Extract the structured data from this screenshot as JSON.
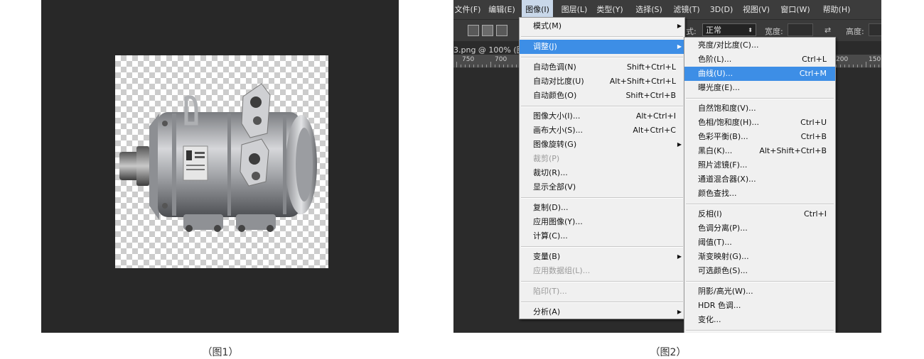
{
  "fig1": {
    "caption": "（图1）"
  },
  "fig2": {
    "caption": "（图2）",
    "menubar": [
      {
        "label": "文件(F)"
      },
      {
        "label": "编辑(E)"
      },
      {
        "label": "图像(I)",
        "active": true
      },
      {
        "label": "图层(L)"
      },
      {
        "label": "类型(Y)"
      },
      {
        "label": "选择(S)"
      },
      {
        "label": "滤镜(T)"
      },
      {
        "label": "3D(D)"
      },
      {
        "label": "视图(V)"
      },
      {
        "label": "窗口(W)"
      },
      {
        "label": "帮助(H)"
      }
    ],
    "options": {
      "mode_label": "式:",
      "mode_value": "正常",
      "width_label": "宽度:",
      "height_label": "高度:"
    },
    "doc_tab": "3.png @ 100% (图",
    "ruler_left": [
      "750",
      "700"
    ],
    "ruler_right": [
      "200",
      "150"
    ],
    "image_menu": [
      {
        "label": "模式(M)",
        "submenu": true
      },
      {
        "sep": true
      },
      {
        "label": "调整(J)",
        "submenu": true,
        "highlight": true
      },
      {
        "sep": true
      },
      {
        "label": "自动色调(N)",
        "shortcut": "Shift+Ctrl+L"
      },
      {
        "label": "自动对比度(U)",
        "shortcut": "Alt+Shift+Ctrl+L"
      },
      {
        "label": "自动颜色(O)",
        "shortcut": "Shift+Ctrl+B"
      },
      {
        "sep": true
      },
      {
        "label": "图像大小(I)...",
        "shortcut": "Alt+Ctrl+I"
      },
      {
        "label": "画布大小(S)...",
        "shortcut": "Alt+Ctrl+C"
      },
      {
        "label": "图像旋转(G)",
        "submenu": true
      },
      {
        "label": "裁剪(P)",
        "disabled": true
      },
      {
        "label": "裁切(R)..."
      },
      {
        "label": "显示全部(V)"
      },
      {
        "sep": true
      },
      {
        "label": "复制(D)..."
      },
      {
        "label": "应用图像(Y)..."
      },
      {
        "label": "计算(C)..."
      },
      {
        "sep": true
      },
      {
        "label": "变量(B)",
        "submenu": true
      },
      {
        "label": "应用数据组(L)...",
        "disabled": true
      },
      {
        "sep": true
      },
      {
        "label": "陷印(T)...",
        "disabled": true
      },
      {
        "sep": true
      },
      {
        "label": "分析(A)",
        "submenu": true
      }
    ],
    "adjust_menu": [
      {
        "label": "亮度/对比度(C)..."
      },
      {
        "label": "色阶(L)...",
        "shortcut": "Ctrl+L"
      },
      {
        "label": "曲线(U)...",
        "shortcut": "Ctrl+M",
        "highlight": true
      },
      {
        "label": "曝光度(E)..."
      },
      {
        "sep": true
      },
      {
        "label": "自然饱和度(V)..."
      },
      {
        "label": "色相/饱和度(H)...",
        "shortcut": "Ctrl+U"
      },
      {
        "label": "色彩平衡(B)...",
        "shortcut": "Ctrl+B"
      },
      {
        "label": "黑白(K)...",
        "shortcut": "Alt+Shift+Ctrl+B"
      },
      {
        "label": "照片滤镜(F)..."
      },
      {
        "label": "通道混合器(X)..."
      },
      {
        "label": "颜色查找..."
      },
      {
        "sep": true
      },
      {
        "label": "反相(I)",
        "shortcut": "Ctrl+I"
      },
      {
        "label": "色调分离(P)..."
      },
      {
        "label": "阈值(T)..."
      },
      {
        "label": "渐变映射(G)..."
      },
      {
        "label": "可选颜色(S)..."
      },
      {
        "sep": true
      },
      {
        "label": "阴影/高光(W)..."
      },
      {
        "label": "HDR 色调..."
      },
      {
        "label": "变化..."
      },
      {
        "sep": true
      }
    ]
  },
  "colors": {
    "panel_bg": "#282828",
    "menu_bg": "#f0f0f0",
    "highlight": "#3d8ee6",
    "active_menubar": "#c9d8ea"
  }
}
